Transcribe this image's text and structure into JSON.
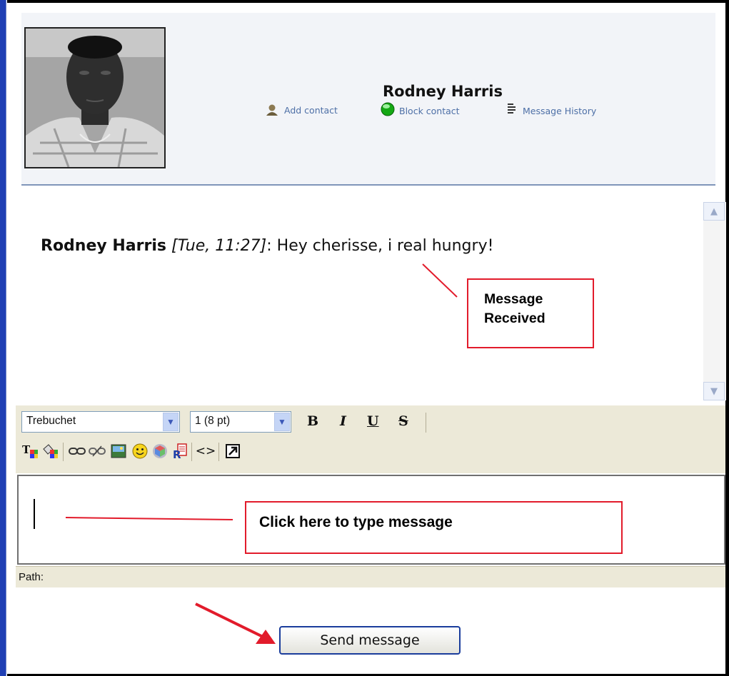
{
  "contact": {
    "name": "Rodney Harris",
    "actions": {
      "add": "Add contact",
      "block": "Block contact",
      "history": "Message History"
    }
  },
  "messages": [
    {
      "sender": "Rodney Harris",
      "time": "[Tue, 11:27]",
      "separator": ":",
      "text": "Hey cherisse, i real hungry!"
    }
  ],
  "annotations": {
    "received": "Message Received",
    "type_here": "Click here to type message"
  },
  "toolbar": {
    "font_family": "Trebuchet",
    "font_size": "1 (8 pt)",
    "bold": "B",
    "italic": "I",
    "underline": "U",
    "strike": "S"
  },
  "editor": {
    "path_label": "Path:"
  },
  "send_label": "Send message",
  "colors": {
    "frame_blue": "#1f3fb4",
    "annotation_red": "#e21b2b",
    "toolbar_bg": "#ece9d8",
    "link_blue": "#4d6fa6"
  }
}
